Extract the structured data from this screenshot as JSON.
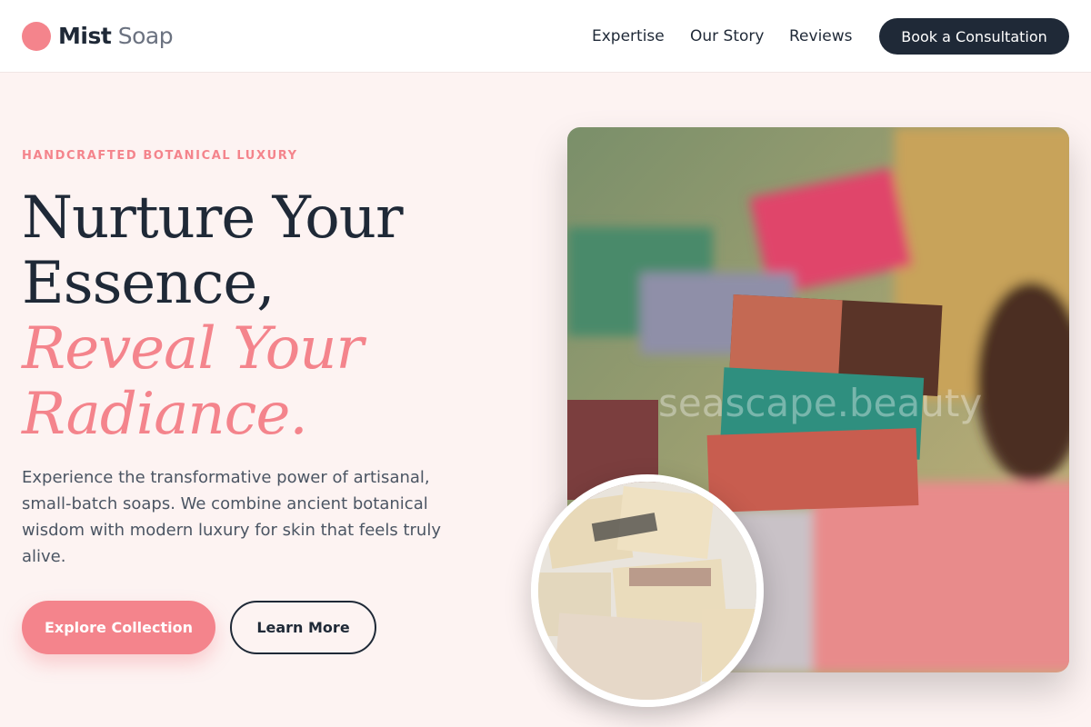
{
  "brand": {
    "name_bold": "Mist",
    "name_light": "Soap",
    "accent": "#f4848c",
    "dark": "#1f2937"
  },
  "nav": {
    "items": [
      "Expertise",
      "Our Story",
      "Reviews"
    ],
    "cta": "Book a Consultation"
  },
  "hero": {
    "eyebrow": "HANDCRAFTED BOTANICAL LUXURY",
    "headline": [
      "Nurture Your",
      "Essence,"
    ],
    "headline_accent": [
      "Reveal Your",
      "Radiance."
    ],
    "description": "Experience the transformative power of artisanal, small-batch soaps. We combine ancient botanical wisdom with modern luxury for skin that feels truly alive.",
    "primary_button": "Explore Collection",
    "secondary_button": "Learn More",
    "image_watermark": "seascape.beauty"
  }
}
